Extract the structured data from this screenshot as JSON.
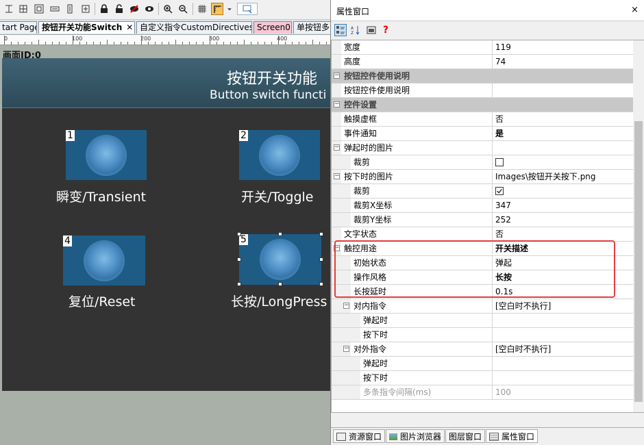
{
  "tabs": [
    {
      "label": "tart Page",
      "active": false
    },
    {
      "label": "按钮开关功能Switch",
      "active": true,
      "close": "✕"
    },
    {
      "label": "自定义指令CustomDirectives",
      "active": false
    },
    {
      "label": "Screen0",
      "active": false
    },
    {
      "label": "单按钮多",
      "active": false
    }
  ],
  "ruler": {
    "labels": [
      "0",
      "100",
      "200",
      "300",
      "400"
    ]
  },
  "canvas": {
    "label": "画面ID:0",
    "header_title": "按钮开关功能",
    "header_subtitle": "Button switch functi",
    "buttons": [
      {
        "num": "1",
        "caption": "瞬变/Transient"
      },
      {
        "num": "2",
        "caption": "开关/Toggle"
      },
      {
        "num": "4",
        "caption": "复位/Reset"
      },
      {
        "num": "5",
        "caption": "长按/LongPress"
      }
    ]
  },
  "panel": {
    "title": "属性窗口",
    "close": "×",
    "tools": [
      "categorized-icon",
      "sort-az-icon",
      "property-pages-icon",
      "help-icon"
    ],
    "help_glyph": "?",
    "rows": [
      {
        "name": "宽度",
        "value": "119"
      },
      {
        "name": "高度",
        "value": "74"
      },
      {
        "name": "按钮控件使用说明",
        "value": "",
        "category": true
      },
      {
        "name": "按钮控件使用说明",
        "value": ""
      },
      {
        "name": "控件设置",
        "value": "",
        "category": true
      },
      {
        "name": "触摸虚框",
        "value": "否"
      },
      {
        "name": "事件通知",
        "value": "是"
      },
      {
        "name": "弹起时的图片",
        "value": ""
      },
      {
        "name": "裁剪",
        "value": "unchecked"
      },
      {
        "name": "按下时的图片",
        "value": "Images\\按钮开关按下.png"
      },
      {
        "name": "裁剪",
        "value": "checked"
      },
      {
        "name": "裁剪X坐标",
        "value": "347"
      },
      {
        "name": "裁剪Y坐标",
        "value": "252"
      },
      {
        "name": "文字状态",
        "value": "否"
      },
      {
        "name": "触控用途",
        "value": "开关描述"
      },
      {
        "name": "初始状态",
        "value": "弹起"
      },
      {
        "name": "操作风格",
        "value": "长按"
      },
      {
        "name": "长按延时",
        "value": "0.1s"
      },
      {
        "name": "对内指令",
        "value": "[空白时不执行]"
      },
      {
        "name": "弹起时",
        "value": ""
      },
      {
        "name": "按下时",
        "value": ""
      },
      {
        "name": "对外指令",
        "value": "[空白时不执行]"
      },
      {
        "name": "弹起时",
        "value": ""
      },
      {
        "name": "按下时",
        "value": ""
      },
      {
        "name": "多条指令间隔(ms)",
        "value": "100"
      }
    ],
    "bottom_tabs": [
      {
        "label": "资源窗口",
        "icon": "resource-icon"
      },
      {
        "label": "图片浏览器",
        "icon": "image-browser-icon"
      },
      {
        "label": "图层窗口",
        "icon": "layer-icon"
      },
      {
        "label": "属性窗口",
        "icon": "property-icon",
        "active": true
      }
    ]
  },
  "colors": {
    "accent": "#f7c25c",
    "highlight_box": "#e53c3c",
    "button_fill": "#1e5c86",
    "screen_bg": "#333333"
  }
}
